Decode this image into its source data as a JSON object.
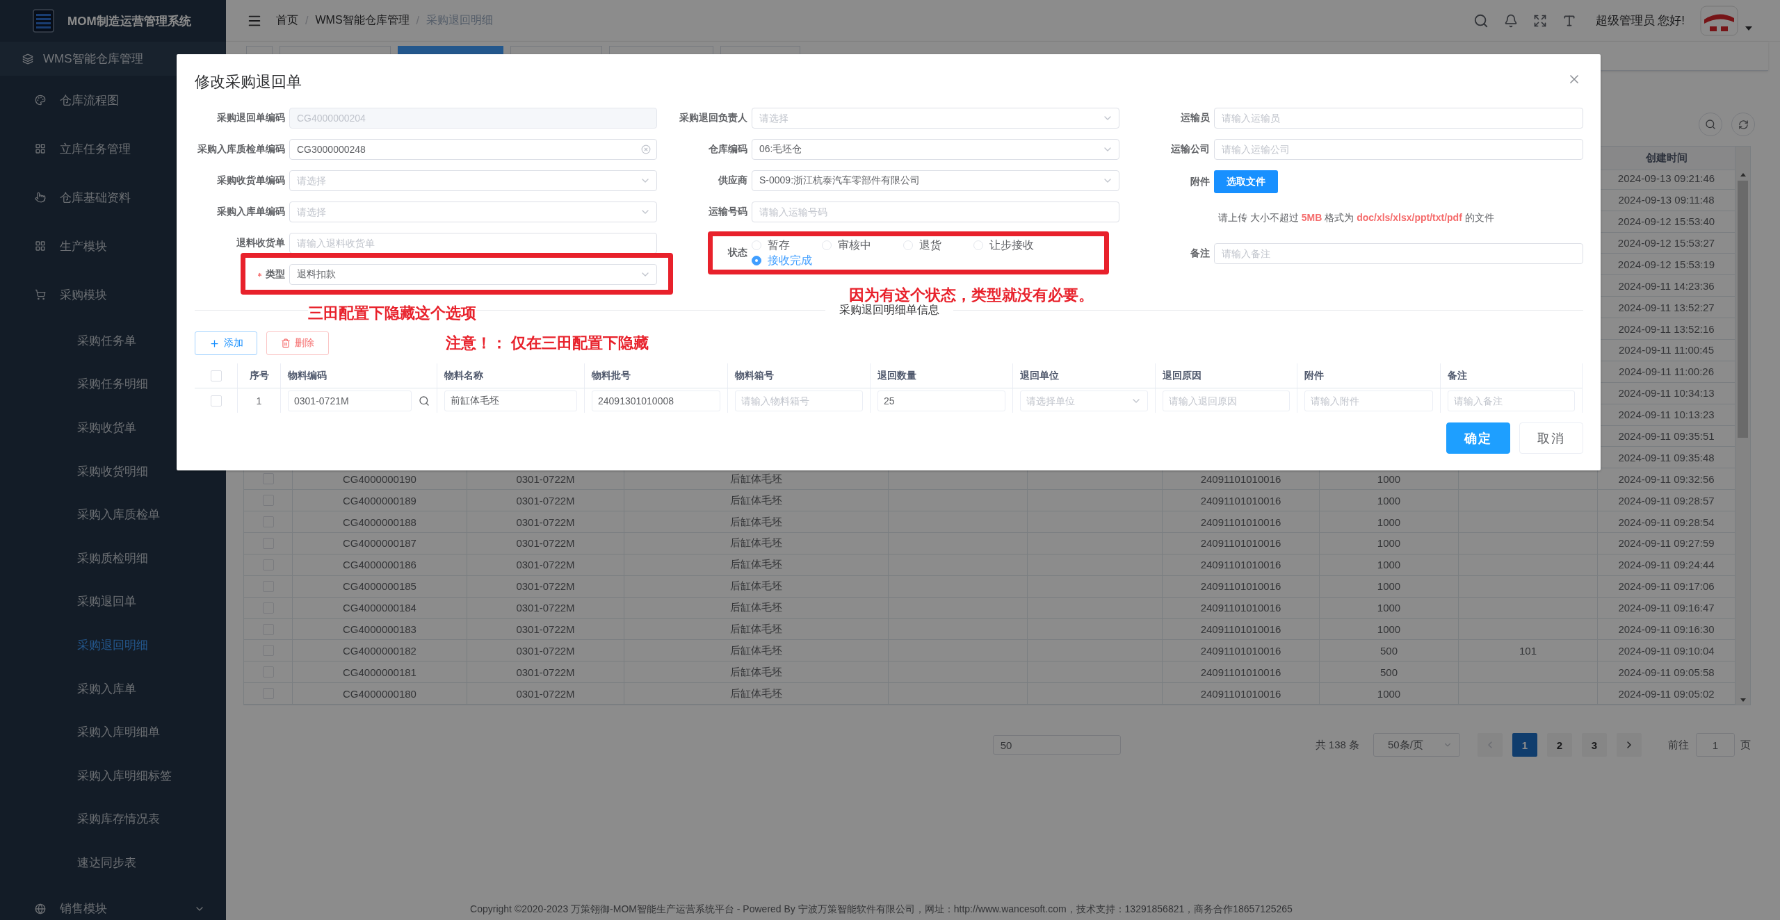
{
  "app_title": "MOM制造运营管理系统",
  "sidebar": {
    "items": [
      {
        "label": "WMS智能仓库管理",
        "children": [
          {
            "label": "仓库流程图"
          },
          {
            "label": "立库任务管理"
          },
          {
            "label": "仓库基础资料"
          },
          {
            "label": "生产模块"
          },
          {
            "label": "采购模块",
            "children": [
              {
                "label": "采购任务单",
                "selected": false
              },
              {
                "label": "采购任务明细",
                "selected": false
              },
              {
                "label": "采购收货单",
                "selected": false
              },
              {
                "label": "采购收货明细",
                "selected": false
              },
              {
                "label": "采购入库质检单",
                "selected": false
              },
              {
                "label": "采购质检明细",
                "selected": false
              },
              {
                "label": "采购退回单",
                "selected": false
              },
              {
                "label": "采购退回明细",
                "selected": true
              },
              {
                "label": "采购入库单",
                "selected": false
              },
              {
                "label": "采购入库明细单",
                "selected": false
              },
              {
                "label": "采购入库明细标签",
                "selected": false
              },
              {
                "label": "采购库存情况表",
                "selected": false
              },
              {
                "label": "速达同步表",
                "selected": false
              }
            ]
          },
          {
            "label": "销售模块",
            "expanded": false
          }
        ]
      }
    ]
  },
  "header": {
    "breadcrumb": [
      {
        "label": "首页"
      },
      {
        "label": "WMS智能仓库管理"
      },
      {
        "label": "采购退回明细"
      }
    ],
    "separator": "/",
    "greeting": "超级管理员 您好!"
  },
  "tab_bar": {
    "tabs": [
      {
        "selected": false
      },
      {
        "selected": false
      },
      {
        "selected": true
      },
      {
        "selected": false
      },
      {
        "selected": false
      },
      {
        "selected": false
      }
    ]
  },
  "records_table": {
    "created_header": "创建时间",
    "rows": [
      {
        "created": "2024-09-13 09:21:46"
      },
      {
        "created": "2024-09-13 09:11:48"
      },
      {
        "created": "2024-09-12 15:53:40"
      },
      {
        "created": "2024-09-12 15:53:27"
      },
      {
        "created": "2024-09-12 15:53:19"
      },
      {
        "created": "2024-09-11 14:23:36"
      },
      {
        "created": "2024-09-11 13:52:27"
      },
      {
        "created": "2024-09-11 13:52:16"
      },
      {
        "created": "2024-09-11 11:00:45"
      },
      {
        "created": "2024-09-11 11:00:26"
      },
      {
        "created": "2024-09-11 10:34:13"
      },
      {
        "created": "2024-09-11 10:13:23"
      },
      {
        "created": "2024-09-11 09:35:51"
      },
      {
        "created": "2024-09-11 09:35:48"
      },
      {
        "checked": false,
        "code": "CG4000000190",
        "material_code": "0301-0722M",
        "material_name": "后缸体毛坯",
        "batch": "24091101010016",
        "quantity": "1000",
        "created": "2024-09-11 09:32:56"
      },
      {
        "checked": false,
        "code": "CG4000000189",
        "material_code": "0301-0722M",
        "material_name": "后缸体毛坯",
        "batch": "24091101010016",
        "quantity": "1000",
        "created": "2024-09-11 09:28:57"
      },
      {
        "checked": false,
        "code": "CG4000000188",
        "material_code": "0301-0722M",
        "material_name": "后缸体毛坯",
        "batch": "24091101010016",
        "quantity": "1000",
        "created": "2024-09-11 09:28:54"
      },
      {
        "checked": false,
        "code": "CG4000000187",
        "material_code": "0301-0722M",
        "material_name": "后缸体毛坯",
        "batch": "24091101010016",
        "quantity": "1000",
        "created": "2024-09-11 09:27:59"
      },
      {
        "checked": false,
        "code": "CG4000000186",
        "material_code": "0301-0722M",
        "material_name": "后缸体毛坯",
        "batch": "24091101010016",
        "quantity": "1000",
        "created": "2024-09-11 09:24:44"
      },
      {
        "checked": false,
        "code": "CG4000000185",
        "material_code": "0301-0722M",
        "material_name": "后缸体毛坯",
        "batch": "24091101010016",
        "quantity": "1000",
        "created": "2024-09-11 09:17:06"
      },
      {
        "checked": false,
        "code": "CG4000000184",
        "material_code": "0301-0722M",
        "material_name": "后缸体毛坯",
        "batch": "24091101010016",
        "quantity": "1000",
        "created": "2024-09-11 09:16:47"
      },
      {
        "checked": false,
        "code": "CG4000000183",
        "material_code": "0301-0722M",
        "material_name": "后缸体毛坯",
        "batch": "24091101010016",
        "quantity": "1000",
        "created": "2024-09-11 09:16:30"
      },
      {
        "checked": false,
        "code": "CG4000000182",
        "material_code": "0301-0722M",
        "material_name": "后缸体毛坯",
        "batch": "24091101010016",
        "quantity": "500",
        "column_9": "101",
        "created": "2024-09-11 09:10:04"
      },
      {
        "checked": false,
        "code": "CG4000000181",
        "material_code": "0301-0722M",
        "material_name": "后缸体毛坯",
        "batch": "24091101010016",
        "quantity": "500",
        "created": "2024-09-11 09:05:58"
      },
      {
        "checked": false,
        "code": "CG4000000180",
        "material_code": "0301-0722M",
        "material_name": "后缸体毛坯",
        "batch": "24091101010016",
        "quantity": "1000",
        "created": "2024-09-11 09:05:02"
      }
    ]
  },
  "pagination": {
    "input_value": "50",
    "total": "共 138 条",
    "page_size": "50条/页",
    "pages": [
      {
        "label": "1",
        "selected": true
      },
      {
        "label": "2",
        "selected": false
      },
      {
        "label": "3",
        "selected": false
      }
    ],
    "goto_label": "前往",
    "goto_value": "1",
    "goto_unit": "页"
  },
  "footer": "Copyright ©2020-2023 万策翎御-MOM智能生产运营系统平台 - Powered By 宁波万策智能软件有限公司，网址：http://www.wancesoft.com，技术支持：13291856821，商务合作18657125265",
  "dialog": {
    "title": "修改采购退回单",
    "form": {
      "left": [
        {
          "label": "采购退回单编码",
          "kind": "input",
          "value": "CG4000000204",
          "disabled": true
        },
        {
          "label": "采购入库质检单编码",
          "kind": "clearable",
          "value": "CG3000000248"
        },
        {
          "label": "采购收货单编码",
          "kind": "select",
          "placeholder": "请选择"
        },
        {
          "label": "采购入库单编码",
          "kind": "select",
          "placeholder": "请选择"
        },
        {
          "label": "退料收货单",
          "kind": "input",
          "placeholder": "请输入退料收货单"
        },
        {
          "label": "类型",
          "kind": "select",
          "value": "退料扣款",
          "required": true,
          "highlighted": true,
          "note": "三田配置下隐藏这个选项"
        }
      ],
      "middle": [
        {
          "label": "采购退回负责人",
          "kind": "select",
          "placeholder": "请选择"
        },
        {
          "label": "仓库编码",
          "kind": "select",
          "value": "06:毛坯仓"
        },
        {
          "label": "供应商",
          "kind": "select",
          "value": "S-0009:浙江杭泰汽车零部件有限公司"
        },
        {
          "label": "运输号码",
          "kind": "input",
          "placeholder": "请输入运输号码"
        },
        {
          "label": "状态",
          "kind": "radio",
          "highlighted": true,
          "note": "因为有这个状态，类型就没有必要。",
          "options": [
            {
              "label": "暂存",
              "selected": false
            },
            {
              "label": "审核中",
              "selected": false
            },
            {
              "label": "退货",
              "selected": false
            },
            {
              "label": "让步接收",
              "selected": false
            },
            {
              "label": "接收完成",
              "selected": true
            }
          ]
        }
      ],
      "right": [
        {
          "label": "运输员",
          "kind": "input",
          "placeholder": "请输入运输员"
        },
        {
          "label": "运输公司",
          "kind": "input",
          "placeholder": "请输入运输公司"
        },
        {
          "label": "附件",
          "kind": "upload",
          "button": "选取文件",
          "hint": "请上传 大小不超过 **5MB** 格式为 **doc/xls/xlsx/ppt/txt/pdf** 的文件"
        },
        {
          "label": "备注",
          "kind": "input",
          "placeholder": "请输入备注"
        }
      ]
    },
    "section_title": "采购退回明细单信息",
    "toolbar": {
      "buttons": [
        {
          "label": "添加",
          "kind": "add"
        },
        {
          "label": "删除",
          "kind": "delete"
        }
      ],
      "note": "注意！： 仅在三田配置下隐藏"
    },
    "detail_table": {
      "all_checked": false,
      "columns": [
        "序号",
        "物料编码",
        "物料名称",
        "物料批号",
        "物料箱号",
        "退回数量",
        "退回单位",
        "退回原因",
        "附件",
        "备注"
      ],
      "rows": [
        {
          "checked": false,
          "cells": [
            {
              "kind": "text",
              "value": "1"
            },
            {
              "kind": "search",
              "value": "0301-0721M"
            },
            {
              "kind": "input",
              "value": "前缸体毛坯"
            },
            {
              "kind": "input",
              "value": "24091301010008"
            },
            {
              "kind": "input",
              "placeholder": "请输入物料箱号"
            },
            {
              "kind": "input",
              "value": "25"
            },
            {
              "kind": "select",
              "placeholder": "请选择单位"
            },
            {
              "kind": "input",
              "placeholder": "请输入退回原因"
            },
            {
              "kind": "input",
              "placeholder": "请输入附件"
            },
            {
              "kind": "input",
              "placeholder": "请输入备注"
            }
          ]
        }
      ]
    },
    "buttons": [
      {
        "label": "确定",
        "kind": "primary"
      },
      {
        "label": "取消",
        "kind": "default"
      }
    ]
  }
}
